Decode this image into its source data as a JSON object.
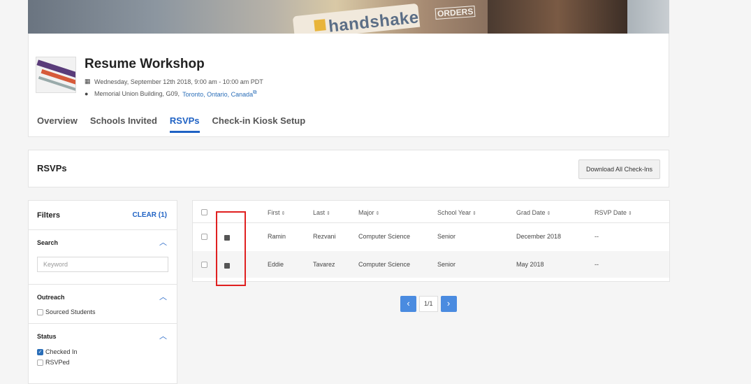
{
  "banner": {
    "logo_text": "handshake",
    "tag_text": "ORDERS"
  },
  "event": {
    "title": "Resume Workshop",
    "date": "Wednesday, September 12th 2018, 9:00 am - 10:00 am PDT",
    "location_prefix": "Memorial Union Building, G09, ",
    "location_link": "Toronto, Ontario, Canada",
    "tabs": [
      "Overview",
      "Schools Invited",
      "RSVPs",
      "Check-in Kiosk Setup"
    ],
    "active_tab": "RSVPs"
  },
  "rsvp_header": {
    "title": "RSVPs",
    "download_label": "Download All Check-Ins"
  },
  "filters": {
    "title": "Filters",
    "clear_label": "CLEAR (1)",
    "search": {
      "label": "Search",
      "placeholder": "Keyword"
    },
    "outreach": {
      "label": "Outreach",
      "options": [
        {
          "label": "Sourced Students",
          "checked": false
        }
      ]
    },
    "status": {
      "label": "Status",
      "options": [
        {
          "label": "Checked In",
          "checked": true
        },
        {
          "label": "RSVPed",
          "checked": false
        }
      ]
    }
  },
  "table": {
    "columns": [
      "First",
      "Last",
      "Major",
      "School Year",
      "Grad Date",
      "RSVP Date"
    ],
    "sort_icon": "⇕",
    "rows": [
      {
        "first": "Ramin",
        "last": "Rezvani",
        "major": "Computer Science",
        "year": "Senior",
        "grad": "December 2018",
        "rsvp": "--"
      },
      {
        "first": "Eddie",
        "last": "Tavarez",
        "major": "Computer Science",
        "year": "Senior",
        "grad": "May 2018",
        "rsvp": "--"
      }
    ]
  },
  "pagination": {
    "prev": "‹",
    "page": "1/1",
    "next": "›"
  },
  "colors": {
    "accent": "#1f62c4",
    "pager": "#4a8be0",
    "highlight": "#e02020"
  }
}
